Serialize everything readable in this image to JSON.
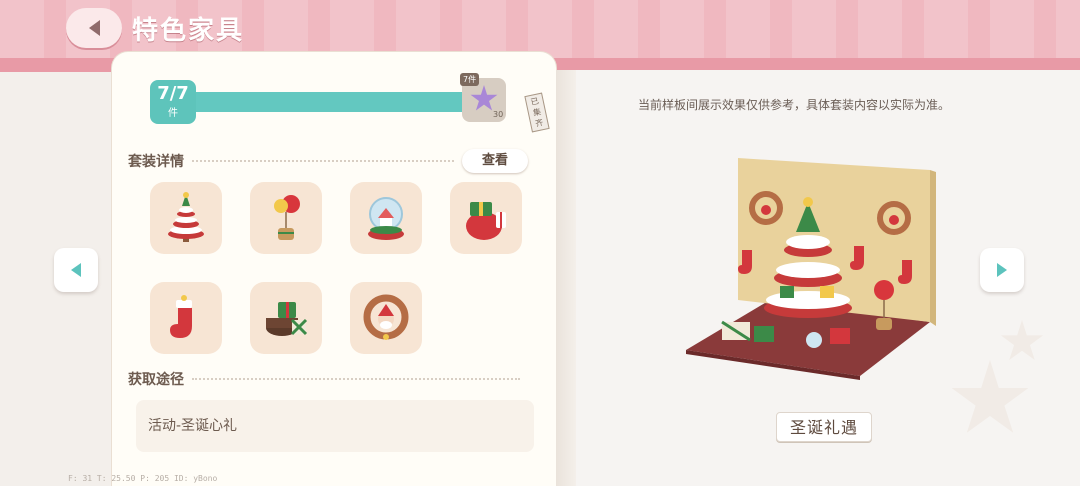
{
  "header": {
    "title": "特色家具"
  },
  "progress": {
    "count_text": "7/7",
    "unit": "件",
    "collected": 7,
    "total": 7,
    "reward_tag": "7件",
    "reward_qty": "30",
    "ribbon": "已集齐"
  },
  "set_detail": {
    "label": "套装详情",
    "view_button": "查看",
    "items": [
      {
        "icon": "christmas-tree-cake-icon"
      },
      {
        "icon": "balloon-basket-icon"
      },
      {
        "icon": "snow-globe-icon"
      },
      {
        "icon": "gift-sack-icon"
      },
      {
        "icon": "christmas-stocking-icon"
      },
      {
        "icon": "gift-boxes-icon"
      },
      {
        "icon": "santa-wreath-icon"
      }
    ]
  },
  "source": {
    "label": "获取途径",
    "value": "活动-圣诞心礼"
  },
  "preview": {
    "notice": "当前样板间展示效果仅供参考，具体套装内容以实际为准。",
    "set_name": "圣诞礼遇"
  },
  "debug": "F: 31   T: 25.50   P: 205   ID: yBono",
  "colors": {
    "accent": "#5ec4bb",
    "header": "#f0b8c0",
    "page": "#fffdf7"
  }
}
